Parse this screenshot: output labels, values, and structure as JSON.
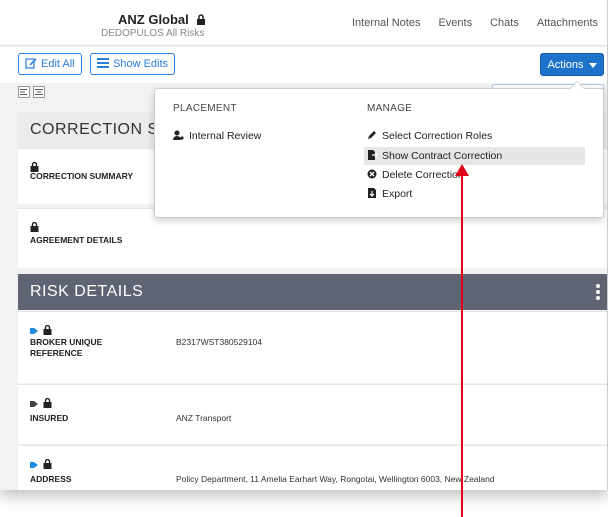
{
  "header": {
    "title": "ANZ Global",
    "subtitle": "DEDOPULOS All Risks",
    "nav": [
      "Internal Notes",
      "Events",
      "Chats",
      "Attachments"
    ]
  },
  "toolbar": {
    "edit_all": "Edit All",
    "show_edits": "Show Edits",
    "actions": "Actions"
  },
  "sections": {
    "correction_title": "CORRECTION SUMMARY",
    "correction_title_visible": "CORRECTION S",
    "risk_title": "RISK DETAILS"
  },
  "correction_rows": [
    {
      "label": "CORRECTION SUMMARY"
    },
    {
      "label": "AGREEMENT DETAILS"
    }
  ],
  "risk_rows": [
    {
      "label": "BROKER UNIQUE REFERENCE",
      "value": "B2317WST380529104"
    },
    {
      "label": "INSURED",
      "value": "ANZ Transport"
    },
    {
      "label": "ADDRESS",
      "value": "Policy Department, 11 Amelia Earhart Way, Rongotai, Wellington 6003, New Zealand"
    }
  ],
  "dropdown": {
    "placement_header": "PLACEMENT",
    "manage_header": "MANAGE",
    "placement_items": [
      "Internal Review"
    ],
    "manage_items": [
      "Select Correction Roles",
      "Show Contract Correction",
      "Delete Correction",
      "Export"
    ]
  },
  "colors": {
    "accent": "#1d72c9",
    "header_dark": "#5e6474",
    "annotation": "#e0001a"
  }
}
